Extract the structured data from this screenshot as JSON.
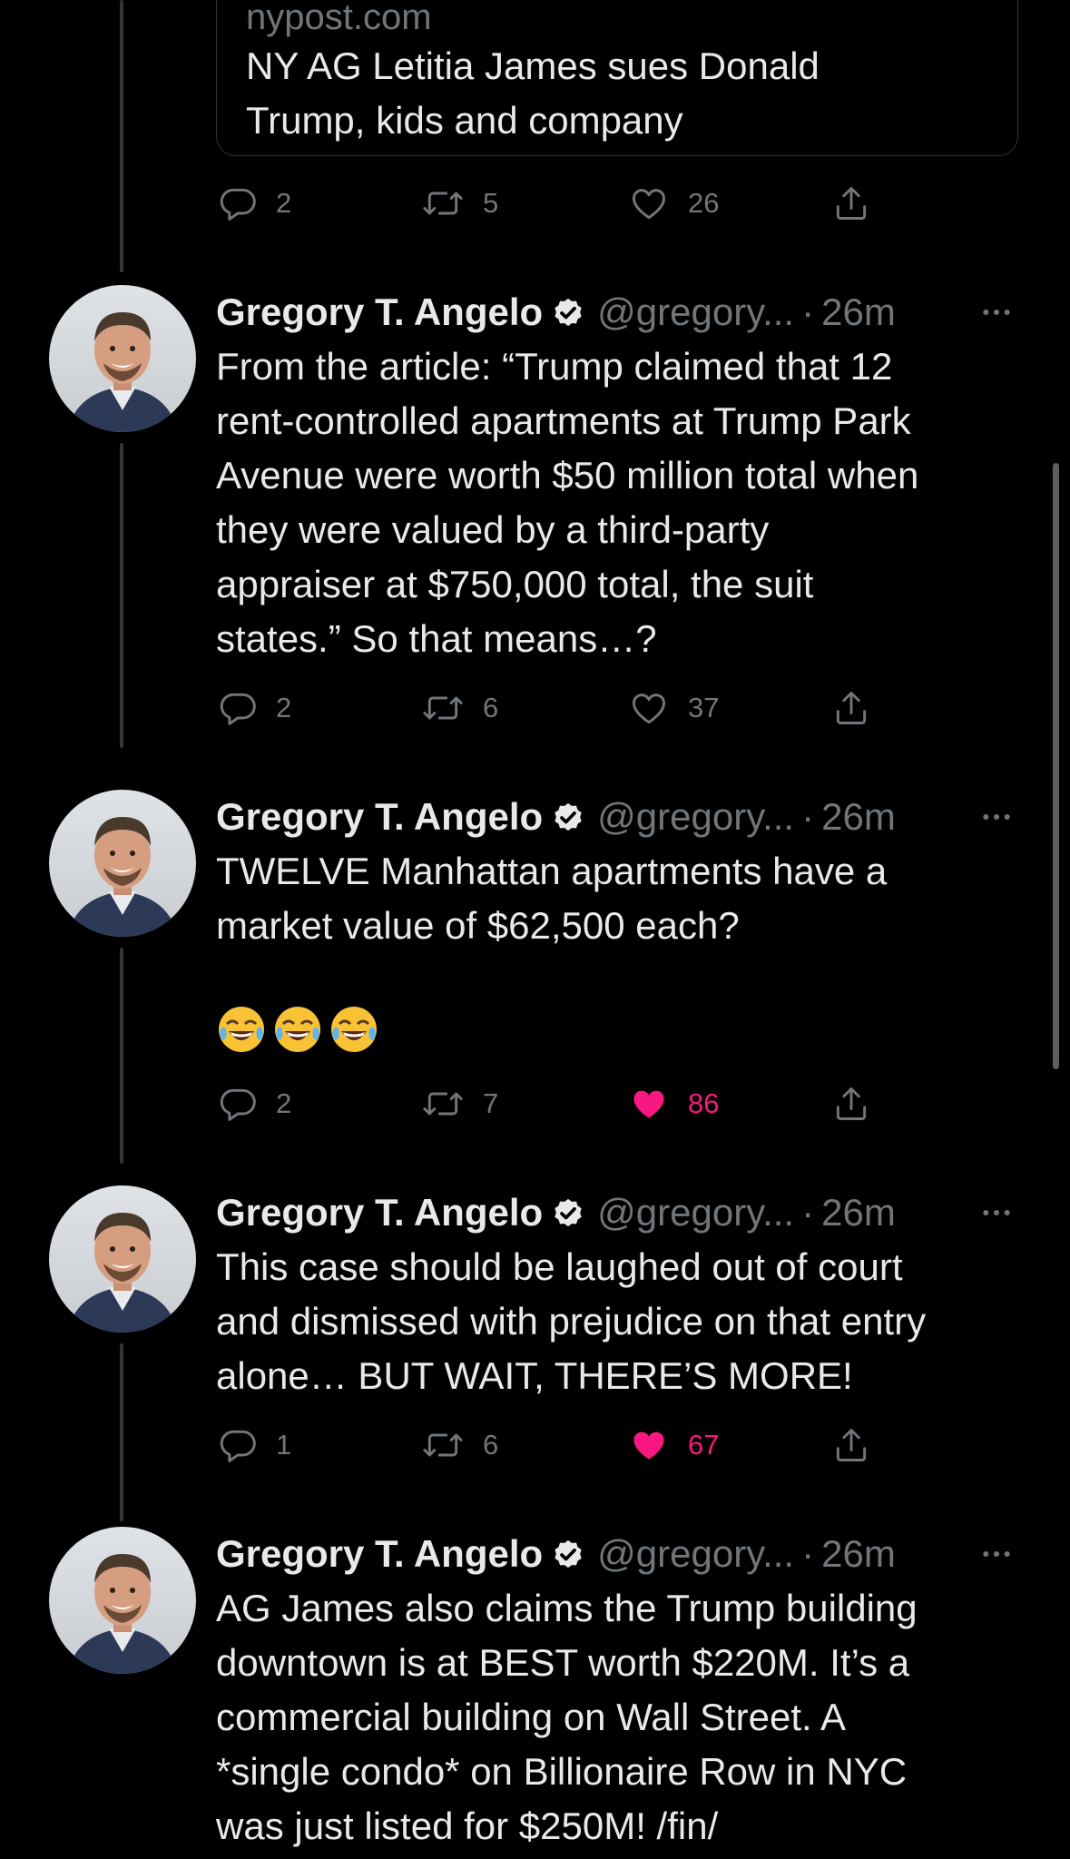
{
  "colors": {
    "background": "#000000",
    "text": "#e7e9ea",
    "muted": "#71767b",
    "like_active": "#f91880",
    "verified": "#e7e9ea"
  },
  "link_card": {
    "domain": "nypost.com",
    "title_lines": [
      "NY AG Letitia James sues Donald",
      "Trump, kids and company"
    ],
    "actions": {
      "replies": "2",
      "retweets": "5",
      "likes": "26",
      "liked": false
    }
  },
  "tweets": [
    {
      "author": "Gregory T. Angelo",
      "handle": "@gregory...",
      "separator": "·",
      "time": "26m",
      "text_lines": [
        "From the article: “Trump claimed that 12",
        "rent-controlled apartments at Trump Park",
        "Avenue were worth $50 million total when",
        "they were valued by a third-party",
        "appraiser at $750,000 total, the suit",
        "states.” So that means…?"
      ],
      "actions": {
        "replies": "2",
        "retweets": "6",
        "likes": "37",
        "liked": false
      }
    },
    {
      "author": "Gregory T. Angelo",
      "handle": "@gregory...",
      "separator": "·",
      "time": "26m",
      "text_lines": [
        "TWELVE Manhattan apartments have a",
        "market value of $62,500 each?"
      ],
      "emoji": "😂😂😂",
      "actions": {
        "replies": "2",
        "retweets": "7",
        "likes": "86",
        "liked": true
      }
    },
    {
      "author": "Gregory T. Angelo",
      "handle": "@gregory...",
      "separator": "·",
      "time": "26m",
      "text_lines": [
        "This case should be laughed out of court",
        "and dismissed with prejudice on that entry",
        "alone… BUT WAIT, THERE’S MORE!"
      ],
      "actions": {
        "replies": "1",
        "retweets": "6",
        "likes": "67",
        "liked": true
      }
    },
    {
      "author": "Gregory T. Angelo",
      "handle": "@gregory...",
      "separator": "·",
      "time": "26m",
      "text_lines": [
        "AG James also claims the Trump building",
        "downtown is at BEST worth $220M. It’s a",
        "commercial building on Wall Street. A",
        "*single condo* on Billionaire Row in NYC",
        "was just listed for $250M! /fin/"
      ]
    }
  ]
}
